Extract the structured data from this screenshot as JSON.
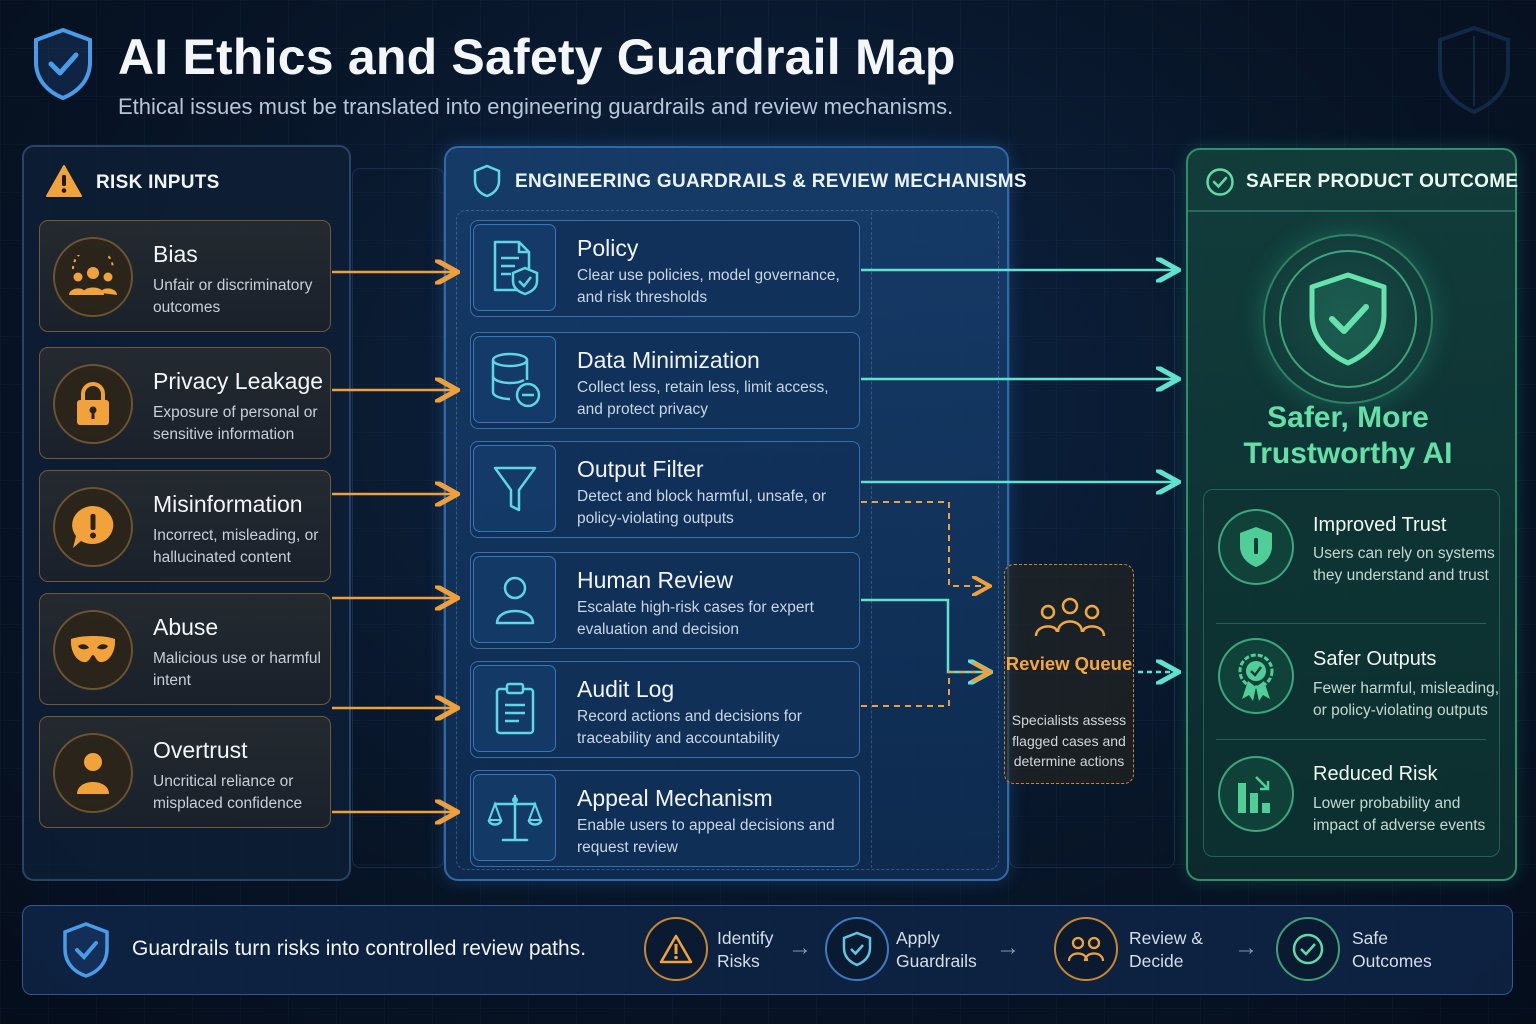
{
  "header": {
    "title": "AI Ethics and Safety Guardrail Map",
    "subtitle": "Ethical issues must be translated into engineering guardrails and review mechanisms."
  },
  "colors": {
    "risk_accent": "#f2a23a",
    "guard_accent": "#5fd6e6",
    "outcome_accent": "#5fdca6",
    "flow_arrow_orange": "#f0a03a",
    "flow_arrow_teal": "#5fe3cf"
  },
  "risk_panel": {
    "heading": "RISK INPUTS",
    "heading_icon": "warning-icon",
    "items": [
      {
        "title": "Bias",
        "desc": "Unfair or discriminatory outcomes",
        "icon": "people-group-icon"
      },
      {
        "title": "Privacy Leakage",
        "desc": "Exposure of personal or sensitive information",
        "icon": "padlock-icon"
      },
      {
        "title": "Misinformation",
        "desc": "Incorrect, misleading, or hallucinated content",
        "icon": "alert-bubble-icon"
      },
      {
        "title": "Abuse",
        "desc": "Malicious use or harmful intent",
        "icon": "mask-icon"
      },
      {
        "title": "Overtrust",
        "desc": "Uncritical reliance or misplaced confidence",
        "icon": "person-icon"
      }
    ]
  },
  "guard_panel": {
    "heading": "ENGINEERING GUARDRAILS & REVIEW MECHANISMS",
    "heading_icon": "shield-icon",
    "items": [
      {
        "title": "Policy",
        "desc": "Clear use policies, model governance, and risk thresholds",
        "icon": "policy-document-icon"
      },
      {
        "title": "Data Minimization",
        "desc": "Collect less, retain less, limit access, and protect privacy",
        "icon": "database-minus-icon"
      },
      {
        "title": "Output Filter",
        "desc": "Detect and block harmful, unsafe, or policy-violating outputs",
        "icon": "funnel-icon"
      },
      {
        "title": "Human Review",
        "desc": "Escalate high-risk cases for expert evaluation and decision",
        "icon": "person-outline-icon"
      },
      {
        "title": "Audit Log",
        "desc": "Record actions and decisions for traceability and accountability",
        "icon": "clipboard-icon"
      },
      {
        "title": "Appeal Mechanism",
        "desc": "Enable users to appeal decisions and request review",
        "icon": "scales-icon"
      }
    ]
  },
  "review_queue": {
    "title": "Review Queue",
    "desc": "Specialists assess flagged cases and determine actions",
    "icon": "team-icon"
  },
  "outcome_panel": {
    "heading": "SAFER PRODUCT OUTCOME",
    "heading_icon": "check-circle-icon",
    "main": "Safer, More Trustworthy AI",
    "main_icon": "shield-check-icon",
    "items": [
      {
        "title": "Improved Trust",
        "desc": "Users can rely on systems they understand and trust",
        "icon": "trust-shield-icon"
      },
      {
        "title": "Safer Outputs",
        "desc": "Fewer harmful, misleading, or policy-violating outputs",
        "icon": "award-badge-icon"
      },
      {
        "title": "Reduced Risk",
        "desc": "Lower probability and impact of adverse events",
        "icon": "bar-chart-down-icon"
      }
    ]
  },
  "bottom_bar": {
    "message": "Guardrails turn risks into controlled review paths.",
    "steps": [
      {
        "label": "Identify Risks",
        "icon": "warning-icon"
      },
      {
        "label": "Apply Guardrails",
        "icon": "shield-check-icon"
      },
      {
        "label": "Review & Decide",
        "icon": "team-icon"
      },
      {
        "label": "Safe Outcomes",
        "icon": "check-circle-icon"
      }
    ]
  }
}
